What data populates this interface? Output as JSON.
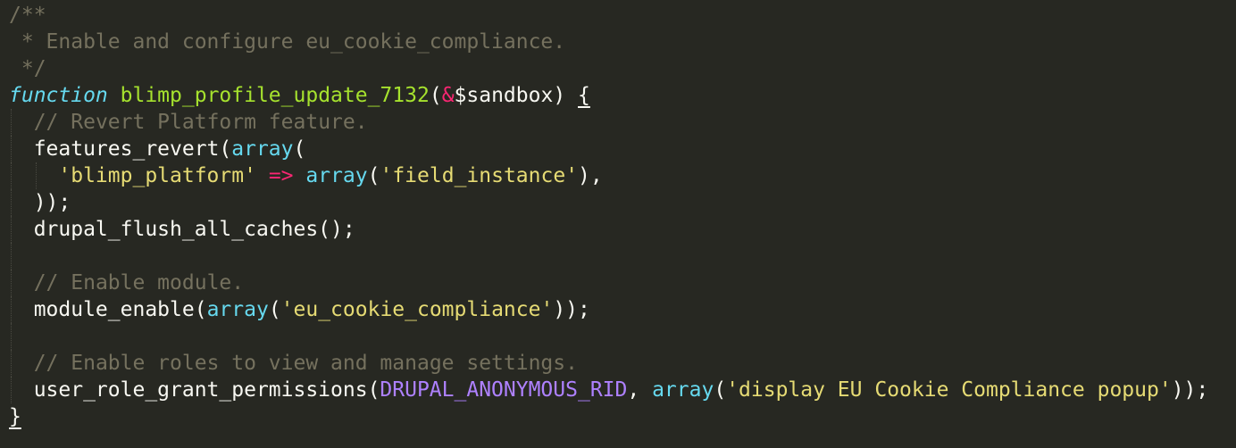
{
  "editor": {
    "theme_colors": {
      "background": "#272822",
      "comment": "#75715E",
      "keyword": "#66D9EF",
      "function_name": "#A6E22E",
      "operator": "#F92672",
      "string": "#E6DB74",
      "constant": "#AE81FF",
      "plain": "#F8F8F2"
    },
    "lines": [
      {
        "tokens": [
          {
            "c": "c",
            "t": "/**"
          }
        ]
      },
      {
        "tokens": [
          {
            "c": "c",
            "t": " * Enable and configure eu_cookie_compliance."
          }
        ]
      },
      {
        "tokens": [
          {
            "c": "c",
            "t": " */"
          }
        ]
      },
      {
        "tokens": [
          {
            "c": "kw",
            "t": "function"
          },
          {
            "c": "pl",
            "t": " "
          },
          {
            "c": "fn",
            "t": "blimp_profile_update_7132"
          },
          {
            "c": "pl",
            "t": "("
          },
          {
            "c": "op",
            "t": "&"
          },
          {
            "c": "pl",
            "t": "$sandbox) "
          },
          {
            "c": "br",
            "t": "{"
          }
        ]
      },
      {
        "indent": 1,
        "tokens": [
          {
            "c": "pl",
            "t": "  "
          },
          {
            "c": "c",
            "t": "// Revert Platform feature."
          }
        ]
      },
      {
        "indent": 1,
        "tokens": [
          {
            "c": "pl",
            "t": "  features_revert("
          },
          {
            "c": "bi",
            "t": "array"
          },
          {
            "c": "pl",
            "t": "("
          }
        ]
      },
      {
        "indent": 2,
        "tokens": [
          {
            "c": "pl",
            "t": "    "
          },
          {
            "c": "st",
            "t": "'blimp_platform'"
          },
          {
            "c": "pl",
            "t": " "
          },
          {
            "c": "op",
            "t": "=>"
          },
          {
            "c": "pl",
            "t": " "
          },
          {
            "c": "bi",
            "t": "array"
          },
          {
            "c": "pl",
            "t": "("
          },
          {
            "c": "st",
            "t": "'field_instance'"
          },
          {
            "c": "pl",
            "t": "),"
          }
        ]
      },
      {
        "indent": 1,
        "tokens": [
          {
            "c": "pl",
            "t": "  ));"
          }
        ]
      },
      {
        "indent": 1,
        "tokens": [
          {
            "c": "pl",
            "t": "  drupal_flush_all_caches();"
          }
        ]
      },
      {
        "indent": 1,
        "tokens": [
          {
            "c": "pl",
            "t": ""
          }
        ]
      },
      {
        "indent": 1,
        "tokens": [
          {
            "c": "pl",
            "t": "  "
          },
          {
            "c": "c",
            "t": "// Enable module."
          }
        ]
      },
      {
        "indent": 1,
        "tokens": [
          {
            "c": "pl",
            "t": "  module_enable("
          },
          {
            "c": "bi",
            "t": "array"
          },
          {
            "c": "pl",
            "t": "("
          },
          {
            "c": "st",
            "t": "'eu_cookie_compliance'"
          },
          {
            "c": "pl",
            "t": "));"
          }
        ]
      },
      {
        "indent": 1,
        "tokens": [
          {
            "c": "pl",
            "t": ""
          }
        ]
      },
      {
        "indent": 1,
        "tokens": [
          {
            "c": "pl",
            "t": "  "
          },
          {
            "c": "c",
            "t": "// Enable roles to view and manage settings."
          }
        ]
      },
      {
        "indent": 1,
        "tokens": [
          {
            "c": "pl",
            "t": "  user_role_grant_permissions("
          },
          {
            "c": "ct",
            "t": "DRUPAL_ANONYMOUS_RID"
          },
          {
            "c": "pl",
            "t": ", "
          },
          {
            "c": "bi",
            "t": "array"
          },
          {
            "c": "pl",
            "t": "("
          },
          {
            "c": "st",
            "t": "'display EU Cookie Compliance popup'"
          },
          {
            "c": "pl",
            "t": "));"
          }
        ]
      },
      {
        "tokens": [
          {
            "c": "br",
            "t": "}"
          }
        ]
      }
    ]
  }
}
